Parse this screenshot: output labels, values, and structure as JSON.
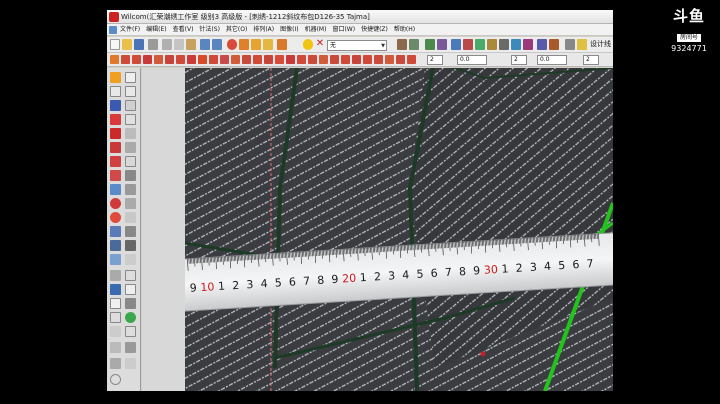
{
  "window": {
    "title": "Wilcom(汇荣潮绣工作室  级别3 高级版 - [刺绣-1212斜纹布包D126-35          Tajma]"
  },
  "menu": [
    "文件(F)",
    "编辑(E)",
    "查看(V)",
    "针法(S)",
    "其它(O)",
    "排列(A)",
    "图像(I)",
    "机器(M)",
    "窗口(W)",
    "快捷键(Z)",
    "帮助(H)"
  ],
  "toolbar": {
    "stitch_combo": "无",
    "stitch_right_label": "设计线",
    "spin_fields": [
      "2",
      "0.0",
      "2",
      "0.0",
      "2"
    ]
  },
  "ruler": {
    "marks": [
      "9",
      "10",
      "1",
      "2",
      "3",
      "4",
      "5",
      "6",
      "7",
      "8",
      "9",
      "20",
      "1",
      "2",
      "3",
      "4",
      "5",
      "6",
      "7",
      "8",
      "9",
      "30",
      "1",
      "2",
      "3",
      "4",
      "5",
      "6",
      "7"
    ]
  },
  "watermark": {
    "logo": "斗鱼",
    "sub": "房间号",
    "room_id": "9324771"
  },
  "colors": {
    "ruler_red": "#d01818",
    "green_line": "#22c41c",
    "fabric": "#3a3c40"
  }
}
